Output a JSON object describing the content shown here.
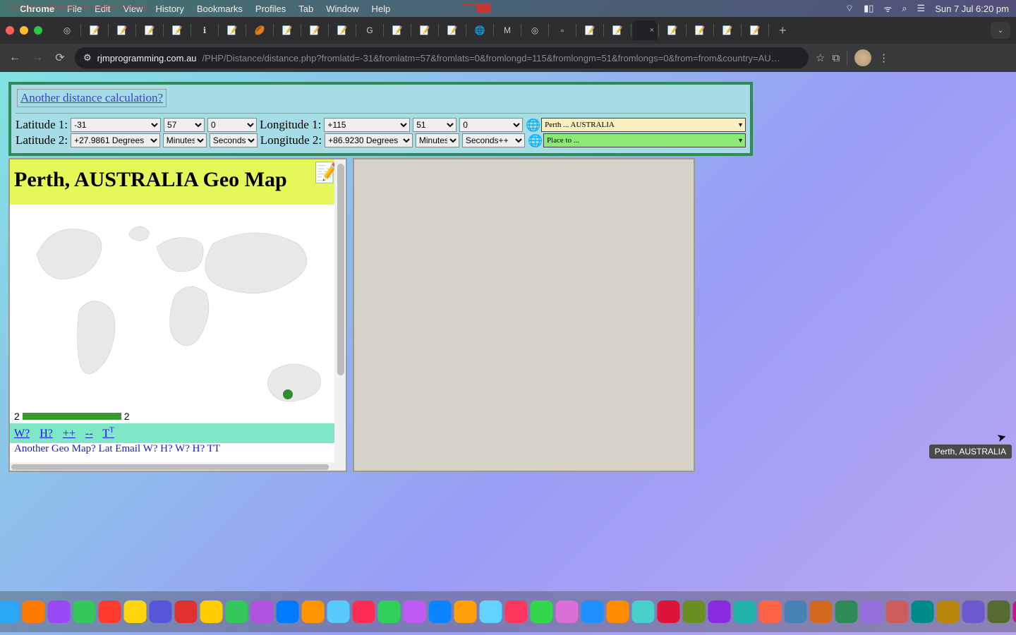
{
  "menubar": {
    "ghost": "Different Places to   Angle Guess",
    "app": "Chrome",
    "items": [
      "File",
      "Edit",
      "View",
      "History",
      "Bookmarks",
      "Profiles",
      "Tab",
      "Window",
      "Help"
    ],
    "clock": "Sun 7 Jul  6:20 pm"
  },
  "tabs": {
    "active_close": "×",
    "new": "+",
    "overflow": "⌄"
  },
  "address": {
    "back": "←",
    "fwd": "→",
    "reload": "⟳",
    "site_chip": "⚙",
    "url_host": "rjmprogramming.com.au",
    "url_path": "/PHP/Distance/distance.php?fromlatd=-31&fromlatm=57&fromlats=0&fromlongd=115&fromlongm=51&fromlongs=0&from=from&country=AU…",
    "star": "☆",
    "ext": "⧉",
    "menu": "⋮"
  },
  "form": {
    "another": "Another distance calculation?",
    "lat1_label": "Latitude 1:",
    "lat1_deg": "-31",
    "lat1_min": "57",
    "lat1_sec": "0",
    "lon1_label": "Longitude 1:",
    "lon1_deg": "+115",
    "lon1_min": "51",
    "lon1_sec": "0",
    "place1": "Perth ... AUSTRALIA",
    "lat2_label": "Latitude 2:",
    "lat2_deg": "+27.9861 Degrees",
    "lat2_min": "Minutes",
    "lat2_sec": "Seconds",
    "lon2_label": "Longitude 2:",
    "lon2_deg": "+86.9230 Degrees",
    "lon2_min": "Minutes",
    "lon2_sec": "Seconds++",
    "place2": "Place to ..."
  },
  "map": {
    "title": "Perth, AUSTRALIA Geo Map",
    "scale_left": "2",
    "scale_right": "2",
    "links": {
      "w": "W?",
      "h": "H?",
      "pp": "++",
      "mm": "--",
      "t": "T",
      "tsup": "T"
    },
    "cut": "Another Geo Map?   Lat   Email  W? H?   W? H?        T",
    "cut_sup": "T"
  },
  "tooltip": "Perth, AUSTRALIA",
  "dock_colors": [
    "#2a6ef5",
    "#f54291",
    "#2aa8f5",
    "#ff7a00",
    "#9a4af5",
    "#35c759",
    "#ff3b30",
    "#ffd60a",
    "#5856d6",
    "#e03131",
    "#ffcc00",
    "#34c759",
    "#af52de",
    "#007aff",
    "#ff9500",
    "#5ac8fa",
    "#ff2d55",
    "#30d158",
    "#bf5af2",
    "#0a84ff",
    "#ff9f0a",
    "#64d2ff",
    "#ff375f",
    "#32d74b",
    "#da70d6",
    "#1e90ff",
    "#ff8c00",
    "#48d1cc",
    "#dc143c",
    "#6b8e23",
    "#8a2be2",
    "#20b2aa",
    "#ff6347",
    "#4682b4",
    "#d2691e",
    "#2e8b57",
    "#9370db",
    "#cd5c5c",
    "#008b8b",
    "#b8860b",
    "#6a5acd",
    "#556b2f",
    "#c71585"
  ]
}
